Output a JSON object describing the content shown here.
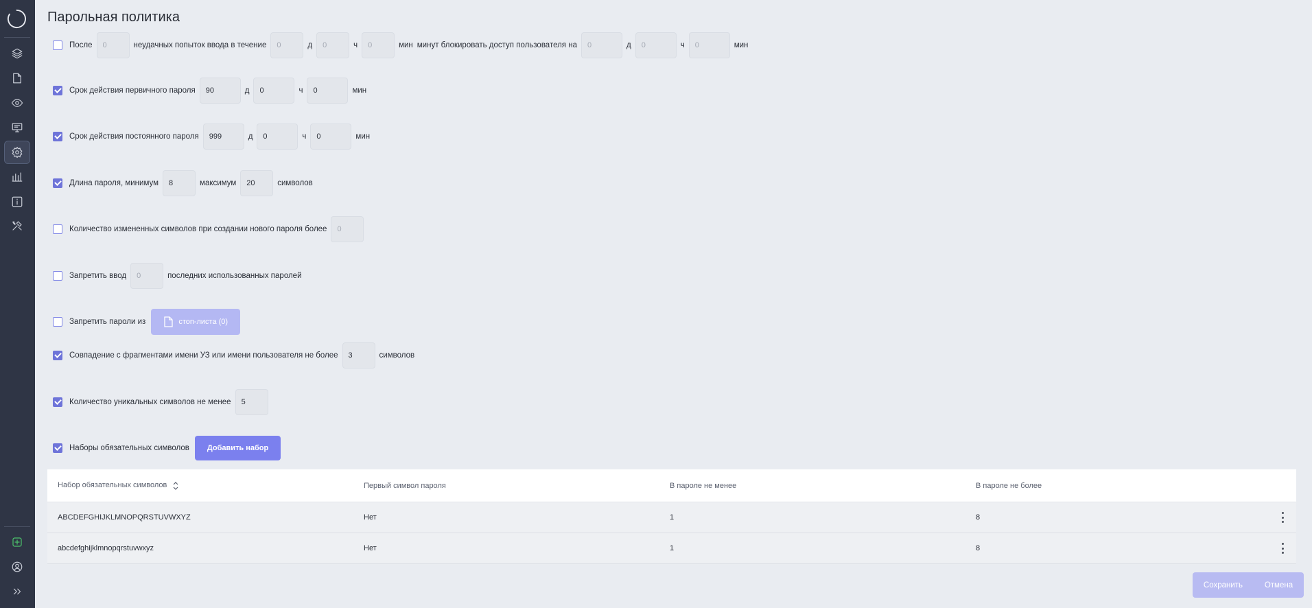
{
  "page": {
    "title": "Парольная политика"
  },
  "sidebar": {
    "items": [
      {
        "icon": "layers-icon"
      },
      {
        "icon": "folder-icon"
      },
      {
        "icon": "eye-icon"
      },
      {
        "icon": "monitor-icon"
      },
      {
        "icon": "gear-icon",
        "active": true
      },
      {
        "icon": "bar-chart-icon"
      },
      {
        "icon": "info-icon"
      },
      {
        "icon": "tools-icon"
      }
    ],
    "bottom": [
      {
        "icon": "plus-icon"
      },
      {
        "icon": "user-icon"
      },
      {
        "icon": "expand-icon"
      }
    ]
  },
  "rows": {
    "lockout": {
      "checked": false,
      "after": "После",
      "attempts": "0",
      "mid": "неудачных попыток ввода в течение",
      "d": "0",
      "d_unit": "д",
      "h": "0",
      "h_unit": "ч",
      "m": "0",
      "m_unit": "мин",
      "tail": "минут блокировать доступ пользователя на",
      "bd": "0",
      "bd_unit": "д",
      "bh": "0",
      "bh_unit": "ч",
      "bm": "0",
      "bm_unit": "мин"
    },
    "primary": {
      "checked": true,
      "label": "Срок действия первичного пароля",
      "d": "90",
      "d_unit": "д",
      "h": "0",
      "h_unit": "ч",
      "m": "0",
      "m_unit": "мин"
    },
    "permanent": {
      "checked": true,
      "label": "Срок действия постоянного пароля",
      "d": "999",
      "d_unit": "д",
      "h": "0",
      "h_unit": "ч",
      "m": "0",
      "m_unit": "мин"
    },
    "length": {
      "checked": true,
      "label": "Длина пароля, минимум",
      "min": "8",
      "mid": "максимум",
      "max": "20",
      "unit": "символов"
    },
    "changed": {
      "checked": false,
      "label": "Количество измененных символов при создании нового пароля более",
      "value": "0"
    },
    "history": {
      "checked": false,
      "label": "Запретить ввод",
      "value": "0",
      "tail": "последних использованных паролей"
    },
    "stoplist": {
      "checked": false,
      "label": "Запретить пароли из",
      "button": "стоп-листа (0)"
    },
    "match": {
      "checked": true,
      "label": "Совпадение с фрагментами имени УЗ или имени пользователя не более",
      "value": "3",
      "unit": "символов"
    },
    "unique": {
      "checked": true,
      "label": "Количество уникальных символов не менее",
      "value": "5"
    },
    "sets": {
      "checked": true,
      "label": "Наборы обязательных символов",
      "button": "Добавить набор"
    }
  },
  "table": {
    "headers": [
      "Набор обязательных символов",
      "Первый символ пароля",
      "В пароле не менее",
      "В пароле не более"
    ],
    "rows": [
      [
        "ABCDEFGHIJKLMNOPQRSTUVWXYZ",
        "Нет",
        "1",
        "8"
      ],
      [
        "abcdefghijklmnopqrstuvwxyz",
        "Нет",
        "1",
        "8"
      ]
    ]
  },
  "footer": {
    "save": "Сохранить",
    "cancel": "Отмена"
  },
  "colors": {
    "accent": "#7b80ee",
    "sidebar": "#2f3545",
    "success": "#4cc36b"
  }
}
